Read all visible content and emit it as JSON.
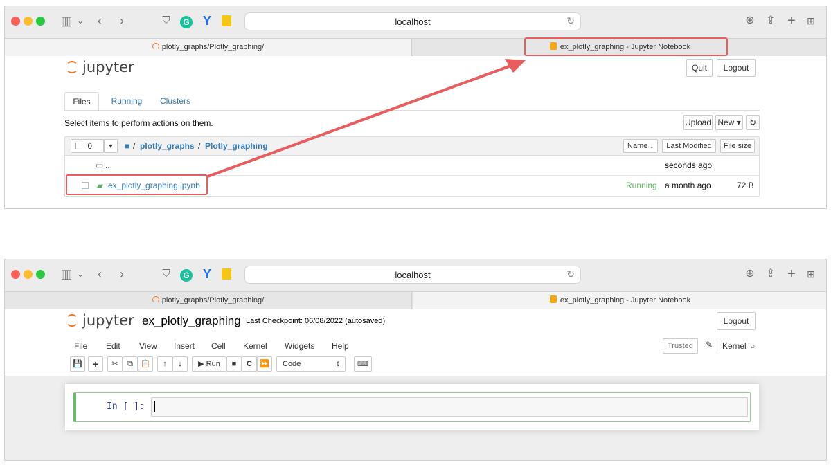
{
  "browser": {
    "url": "localhost",
    "tab1": "plotly_graphs/Plotly_graphing/",
    "tab2": "ex_plotly_graphing - Jupyter Notebook"
  },
  "jupyter": {
    "logo": "jupyter"
  },
  "tree": {
    "quit": "Quit",
    "logout": "Logout",
    "tabs": [
      "Files",
      "Running",
      "Clusters"
    ],
    "hint": "Select items to perform actions on them.",
    "upload": "Upload",
    "new": "New ▾",
    "refresh_icon": "↻",
    "select_count": "0",
    "breadcrumb_sep": "/",
    "crumb1": "plotly_graphs",
    "crumb2": "Plotly_graphing",
    "sort_name": "Name ↓",
    "sort_modified": "Last Modified",
    "sort_size": "File size",
    "parent": "..",
    "parent_modified": "seconds ago",
    "file": {
      "name": "ex_plotly_graphing.ipynb",
      "status": "Running",
      "modified": "a month ago",
      "size": "72 B"
    }
  },
  "notebook": {
    "name": "ex_plotly_graphing",
    "checkpoint": "Last Checkpoint: 06/08/2022  (autosaved)",
    "logout": "Logout",
    "menu": [
      "File",
      "Edit",
      "View",
      "Insert",
      "Cell",
      "Kernel",
      "Widgets",
      "Help"
    ],
    "trusted": "Trusted",
    "kernel": "Kernel",
    "run_label": "▶ Run",
    "cell_type": "Code",
    "prompt": "In [ ]:"
  },
  "colors": {
    "accent": "#337ab7",
    "highlight": "#e85d5d",
    "running": "#5cb85c",
    "jupyter_orange": "#f37726"
  }
}
